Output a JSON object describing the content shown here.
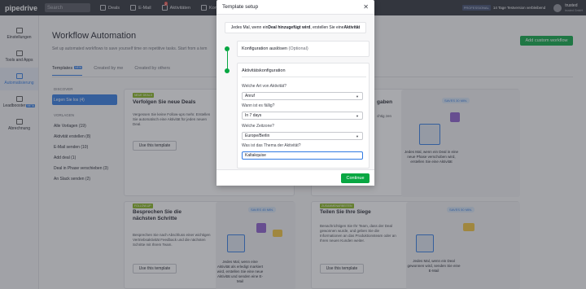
{
  "topbar": {
    "logo": "pipedrive",
    "search_placeholder": "Search",
    "nav": [
      {
        "label": "Deals",
        "icon": "dollar-icon"
      },
      {
        "label": "E-Mail",
        "icon": "mail-icon"
      },
      {
        "label": "Aktivitäten",
        "icon": "calendar-icon",
        "badge": "2"
      },
      {
        "label": "Kontakte",
        "icon": "contacts-icon"
      }
    ],
    "plan_badge": "PROFESSIONAL",
    "trial_text": "14 Tage Testversion verbleibend",
    "user_name": "trusted",
    "user_company": "trusted GmbH"
  },
  "sidebar": {
    "items": [
      {
        "label": "Einstellungen",
        "icon": "gear-icon"
      },
      {
        "label": "Tools and Apps",
        "icon": "tools-icon"
      },
      {
        "label": "Automatisierung",
        "icon": "automation-icon",
        "active": true
      },
      {
        "label": "Leadbooster",
        "icon": "leadbooster-icon",
        "badge": "BETA"
      },
      {
        "label": "Abrechnung",
        "icon": "billing-icon"
      }
    ]
  },
  "main": {
    "title": "Workflow Automation",
    "subtitle": "Set up automated workflows to save yourself time on repetitive tasks. Start from a tem",
    "add_button": "Add custom workflow",
    "tabs": [
      {
        "label": "Templates",
        "badge": "NEW",
        "active": true
      },
      {
        "label": "Created by me"
      },
      {
        "label": "Created by others"
      }
    ],
    "filters": {
      "discover_heading": "DISCOVER",
      "discover_items": [
        "Legen Sie los (4)"
      ],
      "templates_heading": "VORLAGEN",
      "template_items": [
        "Alle Vorlagen (19)",
        "Aktivität erstellen (8)",
        "E-Mail senden (10)",
        "Add deal (1)",
        "Deal in Phase verschieben (3)",
        "An Slack senden (2)"
      ]
    },
    "cards": [
      {
        "tag": "NEUE DEALS",
        "title": "Verfolgen Sie neue Deals",
        "desc": "Vergessen Sie keine Follow-ups mehr. Erstellen Sie automatisch eine Aktivität für jeden neuen Deal.",
        "button": "Use this template"
      },
      {
        "title_partial": "gaben",
        "desc_partial": "chtig\nzen",
        "saves": "SAVES 30 MIN.",
        "art_text": "Jedes Mal, wenn ein Deal in eine neue Phase verschoben wird, erstellen Sie eine Aktivität"
      },
      {
        "tag": "FOLLOW-UP",
        "title": "Besprechen Sie die nächsten Schritte",
        "desc": "Besprechen Sie nach Abschluss einer wichtigen Vertriebsaktivität Feedback und die nächsten Schritte mit Ihrem Team.",
        "button": "Use this template",
        "saves": "SAVES 45 MIN.",
        "art_text": "Jedes Mal, wenn eine Aktivität als erledigt markiert wird, erstellen Sie eine neue Aktivität und senden eine E-Mail"
      },
      {
        "tag": "ZUSAMMENARBEITEN",
        "title": "Teilen Sie Ihre Siege",
        "desc": "Benachrichtigen Sie Ihr Team, dass der Deal gewonnen wurde, und geben Sie die Informationen an das Produktionsteam oder an Ihren neuen Kunden weiter.",
        "button": "Use this template",
        "saves": "SAVES 50 MIN.",
        "art_text": "Jedes Mal, wenn ein Deal gewonnen wird, senden Sie eine E-Mail"
      }
    ]
  },
  "modal": {
    "title": "Template setup",
    "close_icon": "close-icon",
    "summary_pre": "Jedes Mal, wenn ein ",
    "summary_trigger": "Deal hinzugefügt wird",
    "summary_mid": ", erstellen Sie eine ",
    "summary_action": "Aktivität",
    "trigger_section": {
      "title": "Konfiguration auslösen",
      "optional": "(Optional)"
    },
    "activity_section": {
      "title": "Aktivitätskonfiguration",
      "fields": [
        {
          "label": "Welche Art von Aktivität?",
          "value": "Anruf",
          "type": "select"
        },
        {
          "label": "Wann ist es fällig?",
          "value": "In 7 days",
          "type": "select"
        },
        {
          "label": "Welche Zeitzone?",
          "value": "Europe/Berlin",
          "type": "select"
        },
        {
          "label": "Was ist das Thema der Aktivität?",
          "value": "Kaltakquise",
          "type": "text"
        }
      ]
    },
    "continue_button": "Continue"
  },
  "colors": {
    "accent_green": "#08a742",
    "accent_blue": "#317ae2",
    "topbar": "#2d3038"
  }
}
